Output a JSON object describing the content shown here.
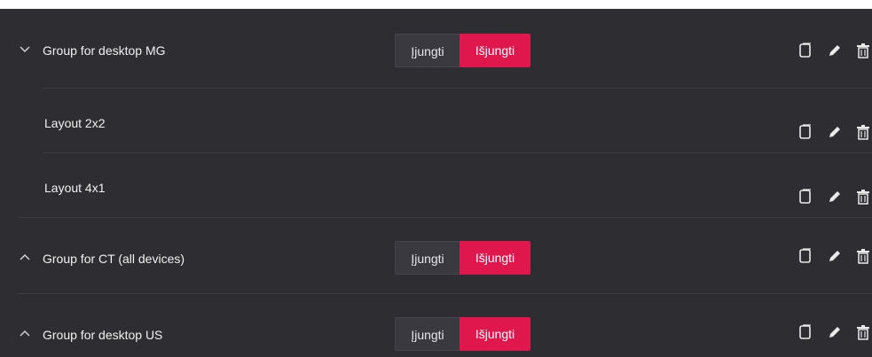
{
  "colors": {
    "panel": "#2e2d31",
    "accent": "#e0174c",
    "divider": "#3d3c41",
    "text": "#f1f1f1"
  },
  "groups": [
    {
      "name": "Group for desktop MG",
      "expanded": true,
      "toggle_on": "Įjungti",
      "toggle_off": "Išjungti",
      "chevron": "chevron-down-icon"
    },
    {
      "name": "Group for CT (all devices)",
      "expanded": false,
      "toggle_on": "Įjungti",
      "toggle_off": "Išjungti",
      "chevron": "chevron-up-icon"
    },
    {
      "name": "Group for desktop US",
      "expanded": false,
      "toggle_on": "Įjungti",
      "toggle_off": "Išjungti",
      "chevron": "chevron-up-icon"
    }
  ],
  "layouts": [
    {
      "name": "Layout 2x2"
    },
    {
      "name": "Layout 4x1"
    }
  ],
  "row_actions": [
    "copy-icon",
    "edit-icon",
    "delete-icon"
  ]
}
